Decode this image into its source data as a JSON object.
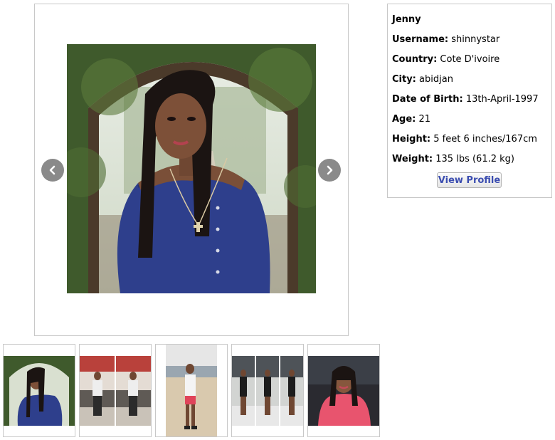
{
  "carousel": {
    "main_photo_alt": "profile photo",
    "prev_icon": "chevron-left-icon",
    "next_icon": "chevron-right-icon"
  },
  "profile": {
    "name": "Jenny",
    "username_label": "Username:",
    "username": "shinnystar",
    "country_label": "Country:",
    "country": "Cote D'ivoire",
    "city_label": "City:",
    "city": "abidjan",
    "dob_label": "Date of Birth:",
    "dob": "13th-April-1997",
    "age_label": "Age:",
    "age": "21",
    "height_label": "Height:",
    "height": "5 feet 6 inches/167cm",
    "weight_label": "Weight:",
    "weight": "135 lbs (61.2 kg)",
    "view_profile_label": "View Profile"
  },
  "thumbnails": [
    {
      "name": "thumbnail-1"
    },
    {
      "name": "thumbnail-2"
    },
    {
      "name": "thumbnail-3"
    },
    {
      "name": "thumbnail-4"
    },
    {
      "name": "thumbnail-5"
    }
  ],
  "colors": {
    "border": "#c8c8c8",
    "nav_button": "#8a8a8a",
    "link_blue": "#3b4db0"
  }
}
